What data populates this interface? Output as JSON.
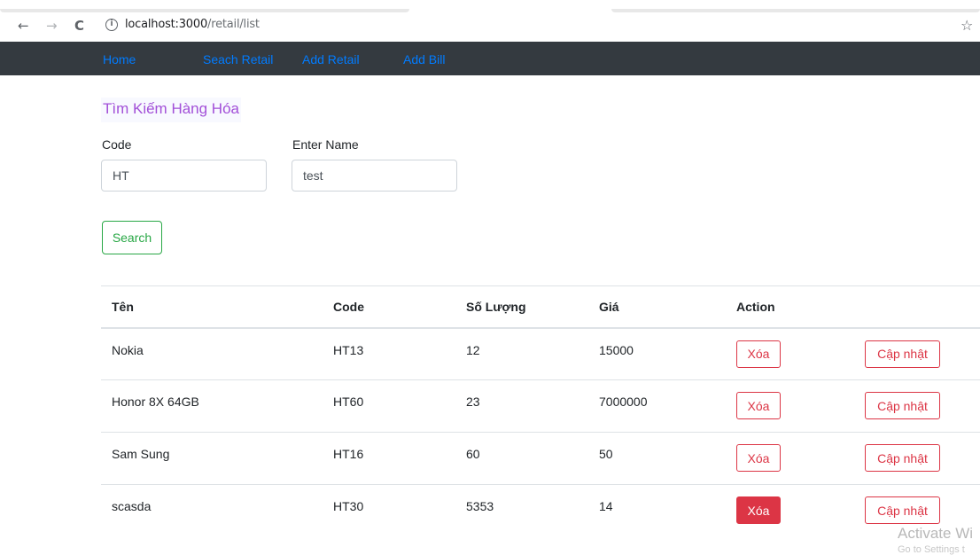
{
  "browser": {
    "url_host": "localhost:3000",
    "url_path": "/retail/list",
    "back_glyph": "←",
    "forward_glyph": "→",
    "reload_glyph": "C",
    "info_glyph": "i",
    "star_glyph": "☆"
  },
  "navbar": {
    "items": [
      {
        "label": "Home"
      },
      {
        "label": "Seach Retail"
      },
      {
        "label": "Add Retail"
      },
      {
        "label": "Add Bill"
      }
    ]
  },
  "search": {
    "title": "Tìm Kiếm Hàng Hóa",
    "code_label": "Code",
    "code_value": "HT",
    "name_label": "Enter Name",
    "name_value": "test",
    "button_label": "Search"
  },
  "table": {
    "headers": [
      "Tên",
      "Code",
      "Số Lượng",
      "Giá",
      "Action"
    ],
    "delete_label": "Xóa",
    "update_label": "Cập nhật",
    "rows": [
      {
        "name": "Nokia",
        "code": "HT13",
        "quantity": "12",
        "price": "15000"
      },
      {
        "name": "Honor 8X 64GB",
        "code": "HT60",
        "quantity": "23",
        "price": "7000000"
      },
      {
        "name": "Sam Sung",
        "code": "HT16",
        "quantity": "60",
        "price": "50"
      },
      {
        "name": "scasda",
        "code": "HT30",
        "quantity": "5353",
        "price": "14"
      }
    ]
  },
  "watermark": {
    "line1": "Activate Wi",
    "line2": "Go to Settings t"
  },
  "colors": {
    "navbar_bg": "#343a40",
    "link": "#007bff",
    "title": "#a24fd8",
    "success": "#28a745",
    "danger": "#dc3545"
  }
}
